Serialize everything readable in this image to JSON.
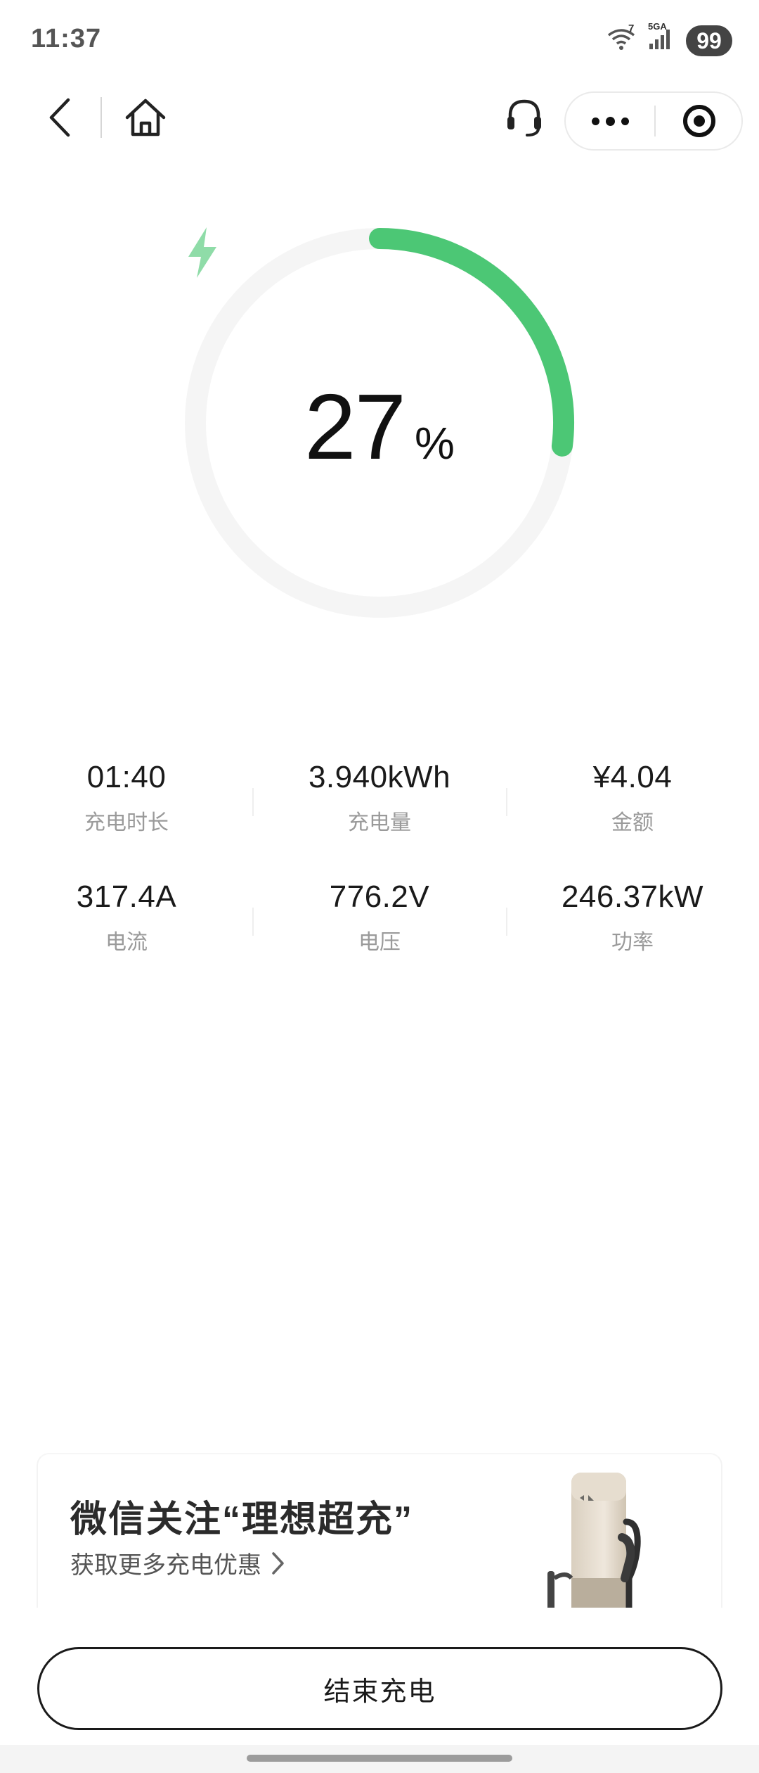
{
  "status_bar": {
    "time": "11:37",
    "wifi_badge": "7",
    "network_label": "5GA",
    "battery": "99"
  },
  "gauge": {
    "percent": "27",
    "unit": "%",
    "progress": 0.27,
    "accent_color": "#4cc775",
    "track_color": "#f5f5f5"
  },
  "stats": {
    "row1": [
      {
        "value": "01:40",
        "label": "充电时长"
      },
      {
        "value": "3.940kWh",
        "label": "充电量"
      },
      {
        "value": "¥4.04",
        "label": "金额"
      }
    ],
    "row2": [
      {
        "value": "317.4A",
        "label": "电流"
      },
      {
        "value": "776.2V",
        "label": "电压"
      },
      {
        "value": "246.37kW",
        "label": "功率"
      }
    ]
  },
  "banner": {
    "title": "微信关注“理想超充”",
    "subtitle": "获取更多充电优惠"
  },
  "end_button_label": "结束充电"
}
